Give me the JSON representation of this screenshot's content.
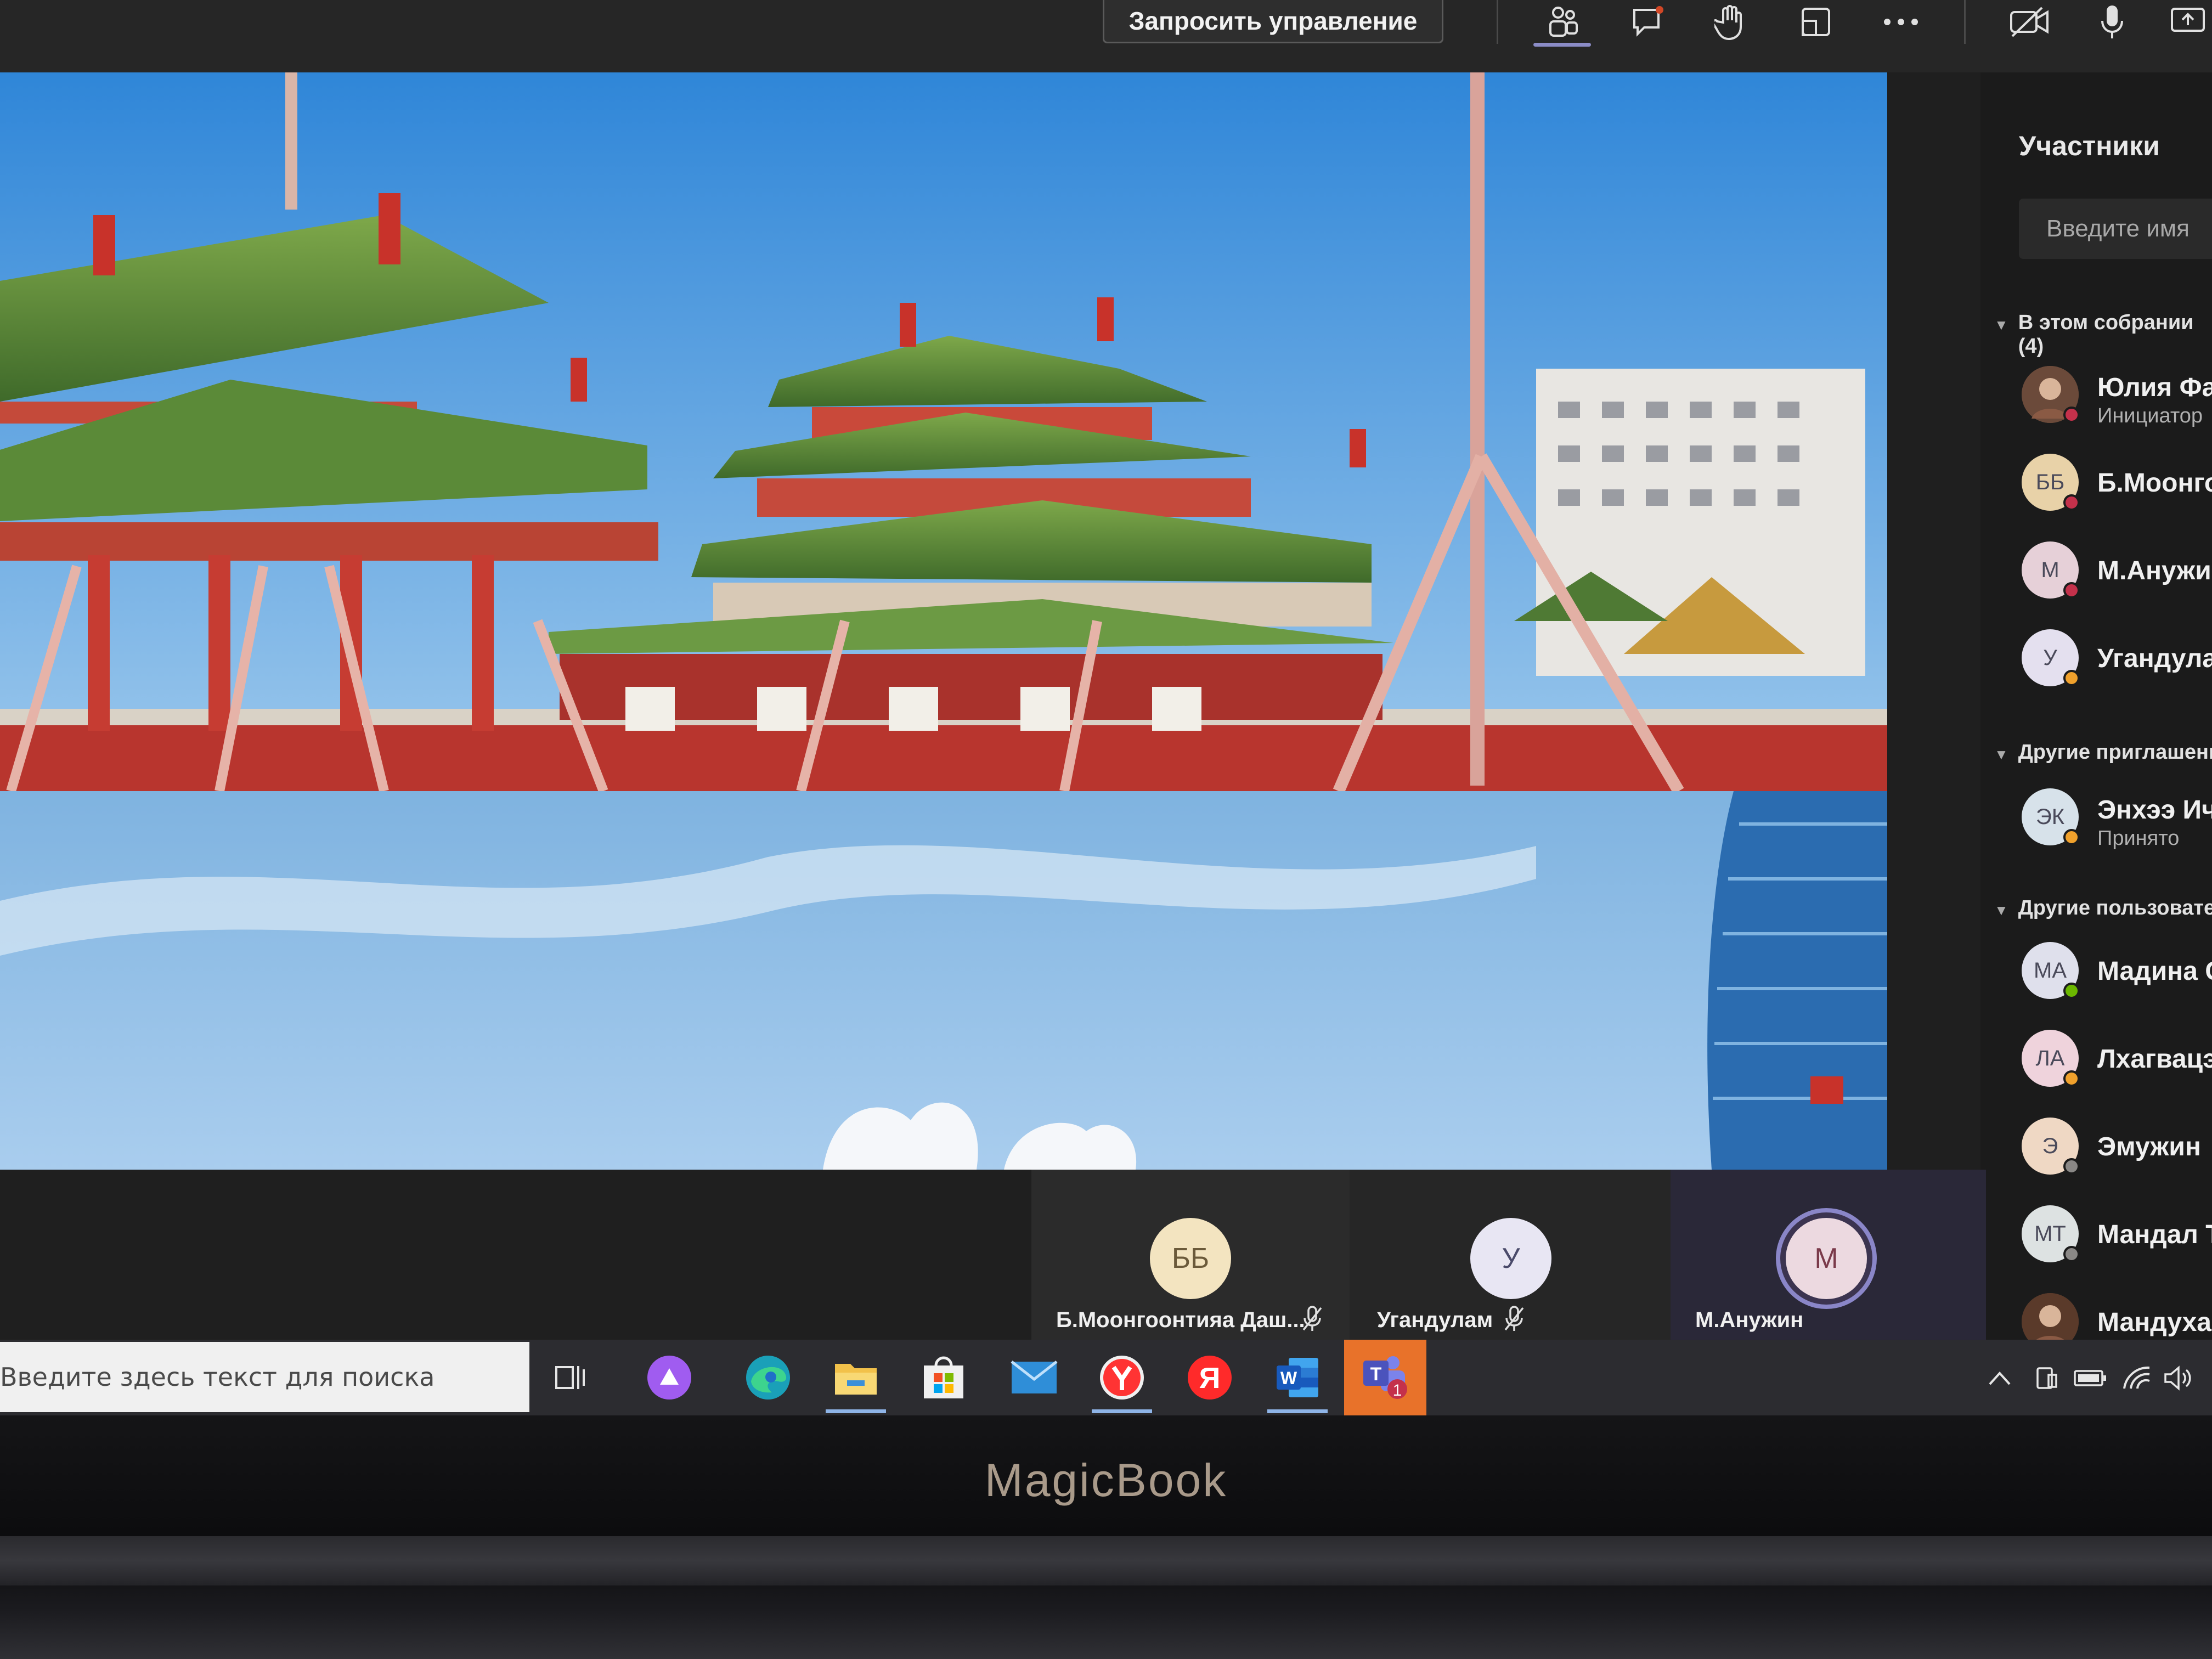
{
  "meeting_toolbar": {
    "request_control_label": "Запросить управление",
    "icons": [
      "people-icon",
      "chat-icon",
      "raise-hand-icon",
      "rooms-icon",
      "more-icon",
      "camera-off-icon",
      "microphone-icon",
      "share-tray-icon"
    ]
  },
  "participants_panel": {
    "title": "Участники",
    "search_placeholder": "Введите имя",
    "sections": [
      {
        "header": "В этом собрании",
        "count": "(4)",
        "items": [
          {
            "initials": "",
            "name": "Юлия Фар",
            "sub": "Инициатор",
            "status": "#c4314b",
            "avatar_bg": "#6b4a3a"
          },
          {
            "initials": "ББ",
            "name": "Б.Моонгос",
            "sub": "",
            "status": "#c4314b",
            "avatar_bg": "#e8d2a8"
          },
          {
            "initials": "М",
            "name": "М.Анужин",
            "sub": "",
            "status": "#c4314b",
            "avatar_bg": "#e6d0d8"
          },
          {
            "initials": "У",
            "name": "Угандулам",
            "sub": "",
            "status": "#f0a12c",
            "avatar_bg": "#e4e0ef"
          }
        ]
      },
      {
        "header": "Другие приглашенн",
        "items": [
          {
            "initials": "ЭК",
            "name": "Энхээ Ичи",
            "sub": "Принято",
            "status": "#f0a12c",
            "avatar_bg": "#d7e2ea"
          }
        ]
      },
      {
        "header": "Другие пользовате",
        "items": [
          {
            "initials": "МА",
            "name": "Мадина С",
            "sub": "",
            "status": "#6bb700",
            "avatar_bg": "#dfe0ec"
          },
          {
            "initials": "ЛА",
            "name": "Лхагвацэр",
            "sub": "",
            "status": "#f0a12c",
            "avatar_bg": "#efd3dc"
          },
          {
            "initials": "Э",
            "name": "Эмужин",
            "sub": "",
            "status": "#8a8886",
            "avatar_bg": "#efd8c4"
          },
          {
            "initials": "МТ",
            "name": "Мандал Т",
            "sub": "",
            "status": "#8a8886",
            "avatar_bg": "#dde2e2"
          },
          {
            "initials": "",
            "name": "Мандухай",
            "sub": "",
            "status": "",
            "avatar_bg": "#5a3a2a"
          }
        ]
      }
    ]
  },
  "tiles": [
    {
      "initials": "ББ",
      "name": "Б.Моонгоонтияа Даш...",
      "muted": true,
      "avatar_bg": "#f3e4c0",
      "avatar_color": "#6b5a3a"
    },
    {
      "initials": "У",
      "name": "Угандулам",
      "muted": true,
      "avatar_bg": "#e8e6f3",
      "avatar_color": "#4a4a6a"
    },
    {
      "initials": "М",
      "name": "М.Анужин",
      "muted": false,
      "avatar_bg": "#ecd9e0",
      "avatar_color": "#7a3a4a"
    }
  ],
  "taskbar": {
    "search_placeholder": "Введите здесь текст для поиска",
    "apps": [
      "task-view-icon",
      "alice-icon",
      "edge-icon",
      "file-explorer-icon",
      "store-icon",
      "mail-icon",
      "yandex-browser-icon",
      "yandex-icon",
      "word-icon",
      "teams-icon"
    ],
    "teams_badge": "1",
    "tray_icons": [
      "chevron-up-icon",
      "tablet-icon",
      "battery-icon",
      "wifi-icon",
      "volume-icon"
    ]
  },
  "laptop": {
    "brand": "MagicBook"
  }
}
